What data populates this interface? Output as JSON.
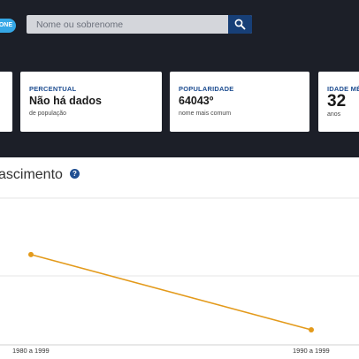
{
  "header": {
    "badge_label": "ONE",
    "search": {
      "placeholder": "Nome ou sobrenome",
      "value": ""
    },
    "search_icon": "search-icon"
  },
  "stats": [
    {
      "label": "",
      "value": "",
      "sub": ""
    },
    {
      "label": "PERCENTUAL",
      "value": "Não há dados",
      "sub": "de população"
    },
    {
      "label": "POPULARIDADE",
      "value": "64043º",
      "sub": "nome mais comum"
    },
    {
      "label": "IDADE MÉ",
      "value": "32",
      "sub": "anos"
    }
  ],
  "section": {
    "title": "ascimento",
    "help_icon": "question-circle-icon"
  },
  "colors": {
    "topbar": "#1c1f28",
    "accent_blue": "#1f4e91",
    "search_button": "#173f77",
    "badge": "#35a7e6",
    "line": "#e39a1b"
  },
  "chart_data": {
    "type": "line",
    "categories": [
      "1980 a 1999",
      "1990 a 1999"
    ],
    "series": [
      {
        "values": [
          1.0,
          0.0
        ]
      }
    ],
    "ylim": [
      -0.2,
      1.75
    ],
    "grid": true,
    "legend": "none"
  }
}
